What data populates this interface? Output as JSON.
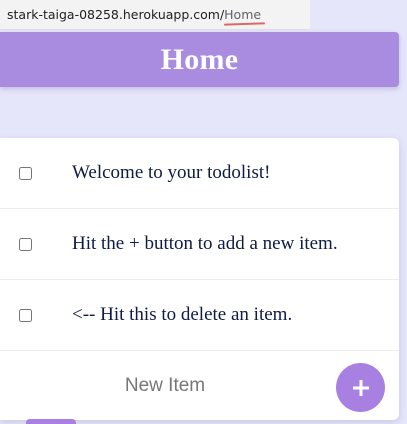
{
  "browser": {
    "url_host": "stark-taiga-08258.herokuapp.com/",
    "url_path": "Home"
  },
  "header": {
    "title": "Home"
  },
  "todos": [
    {
      "text": "Welcome to your todolist!",
      "checked": false
    },
    {
      "text": "Hit the + button to add a new item.",
      "checked": false
    },
    {
      "text": "<-- Hit this to delete an item.",
      "checked": false
    }
  ],
  "new_item": {
    "placeholder": "New Item",
    "value": ""
  },
  "add_button": {
    "icon": "plus-icon"
  },
  "colors": {
    "page_background": "#e6e6fb",
    "accent": "#a98be0",
    "button": "#a780e2",
    "todo_text": "#0f1a45"
  }
}
